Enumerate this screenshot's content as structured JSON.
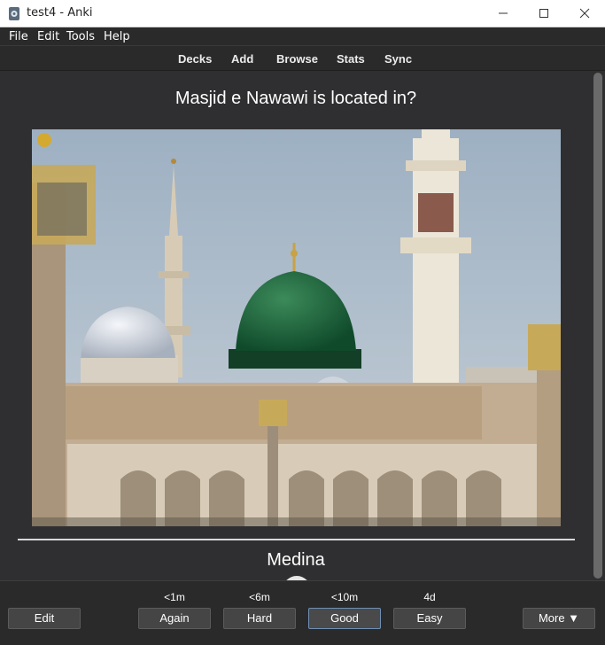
{
  "window": {
    "title": "test4 - Anki"
  },
  "menu": {
    "file": "File",
    "edit": "Edit",
    "tools": "Tools",
    "help": "Help"
  },
  "toolbar": {
    "decks": "Decks",
    "add": "Add",
    "browse": "Browse",
    "stats": "Stats",
    "sync": "Sync"
  },
  "card": {
    "question": "Masjid e Nawawi is located in?",
    "answer": "Medina"
  },
  "bottom": {
    "edit": "Edit",
    "more": "More ▼",
    "answers": [
      {
        "time": "<1m",
        "label": "Again"
      },
      {
        "time": "<6m",
        "label": "Hard"
      },
      {
        "time": "<10m",
        "label": "Good"
      },
      {
        "time": "4d",
        "label": "Easy"
      }
    ]
  }
}
